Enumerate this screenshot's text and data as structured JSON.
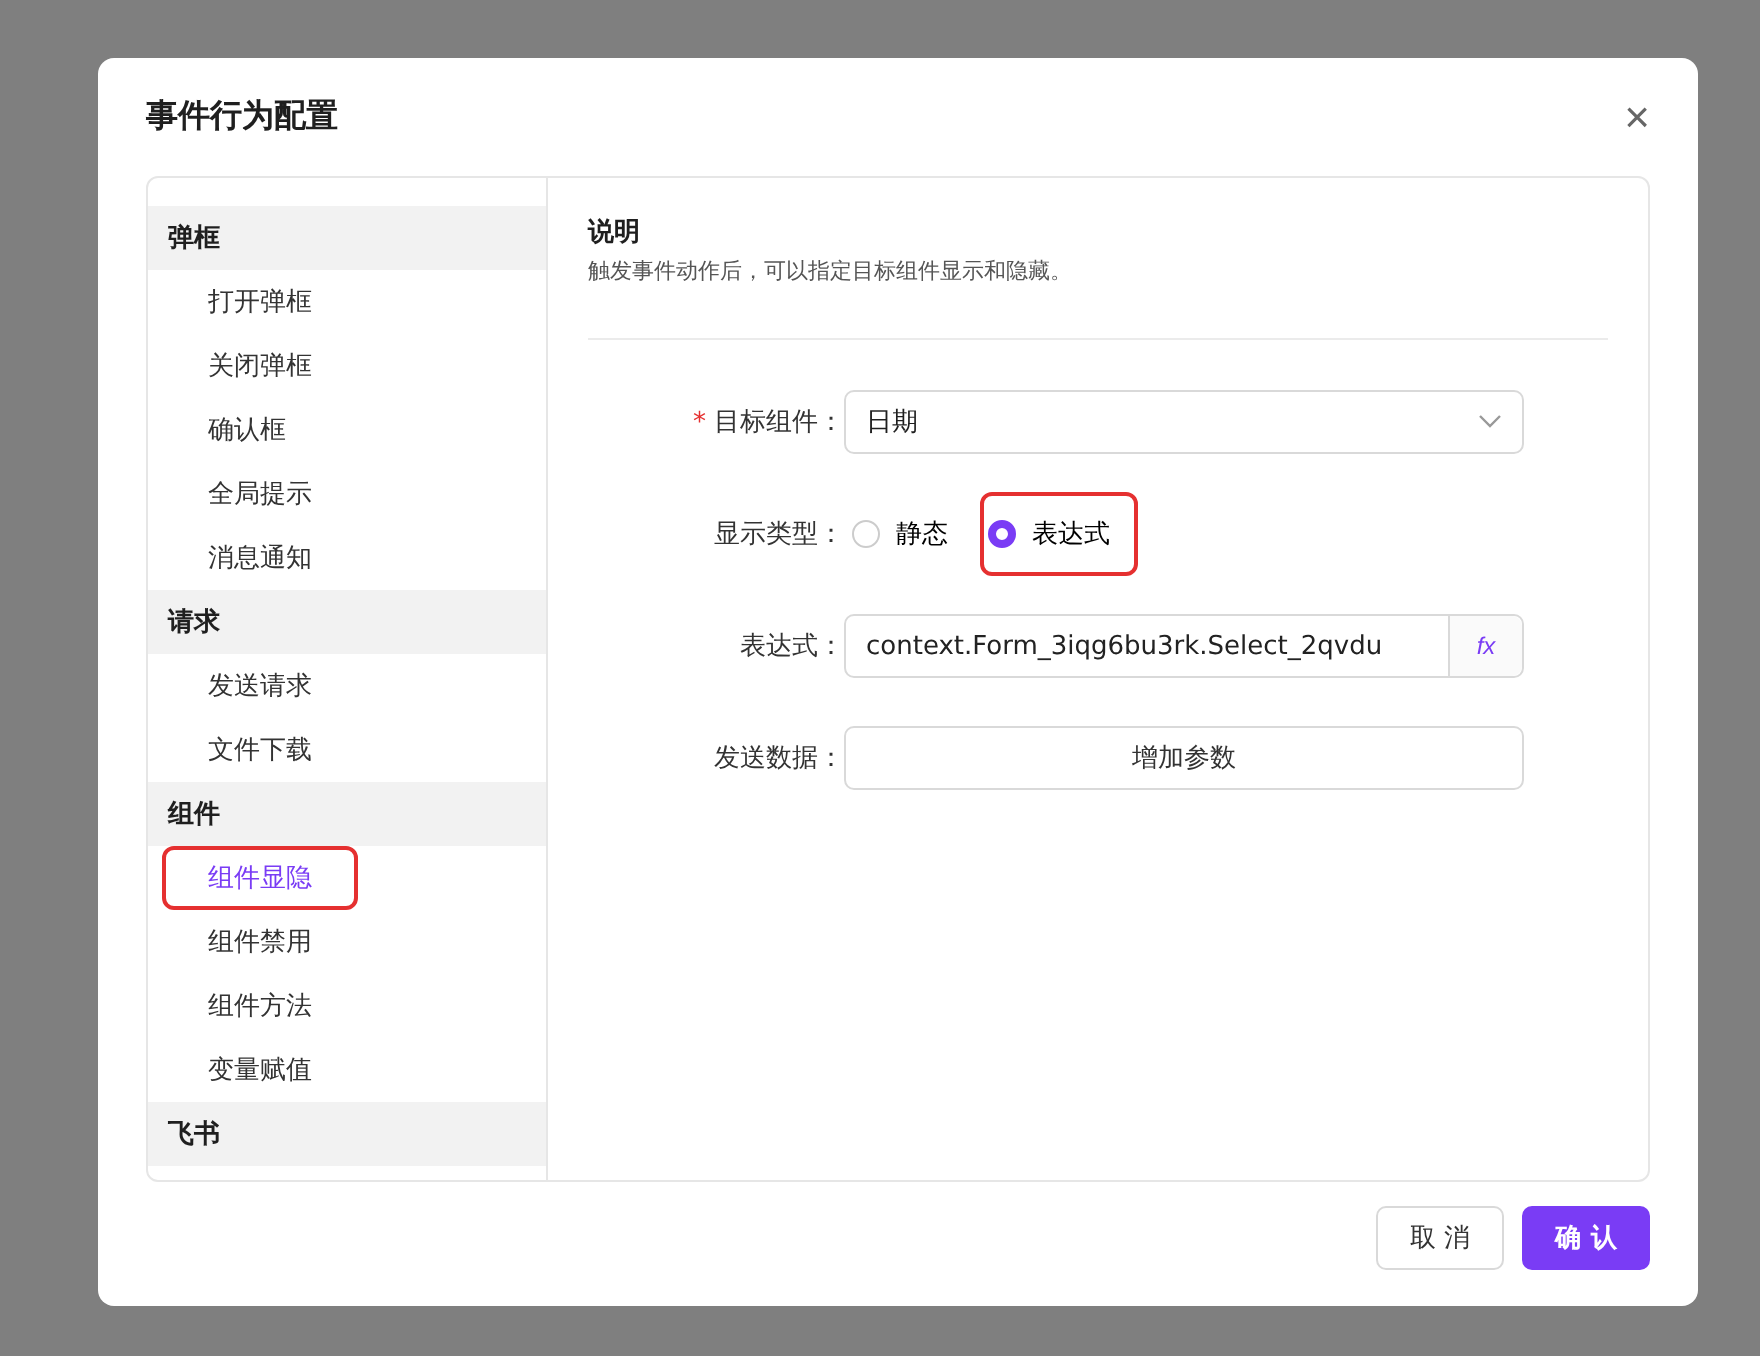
{
  "dialog": {
    "title": "事件行为配置",
    "close": "×"
  },
  "sidebar": {
    "groups": [
      {
        "label": "弹框",
        "items": [
          {
            "label": "打开弹框",
            "selected": false,
            "highlighted": false
          },
          {
            "label": "关闭弹框",
            "selected": false,
            "highlighted": false
          },
          {
            "label": "确认框",
            "selected": false,
            "highlighted": false
          },
          {
            "label": "全局提示",
            "selected": false,
            "highlighted": false
          },
          {
            "label": "消息通知",
            "selected": false,
            "highlighted": false
          }
        ]
      },
      {
        "label": "请求",
        "items": [
          {
            "label": "发送请求",
            "selected": false,
            "highlighted": false
          },
          {
            "label": "文件下载",
            "selected": false,
            "highlighted": false
          }
        ]
      },
      {
        "label": "组件",
        "items": [
          {
            "label": "组件显隐",
            "selected": true,
            "highlighted": true
          },
          {
            "label": "组件禁用",
            "selected": false,
            "highlighted": false
          },
          {
            "label": "组件方法",
            "selected": false,
            "highlighted": false
          },
          {
            "label": "变量赋值",
            "selected": false,
            "highlighted": false
          }
        ]
      },
      {
        "label": "飞书"
      }
    ]
  },
  "description": {
    "title": "说明",
    "text": "触发事件动作后，可以指定目标组件显示和隐藏。"
  },
  "form": [
    {
      "kind": "select",
      "label": "目标组件：",
      "required_mark": "*",
      "value": "日期"
    },
    {
      "kind": "radio",
      "label": "显示类型：",
      "options": [
        {
          "label": "静态",
          "selected": false,
          "highlighted": false
        },
        {
          "label": "表达式",
          "selected": true,
          "highlighted": true
        }
      ]
    },
    {
      "kind": "expression",
      "label": "表达式：",
      "value": "context.Form_3iqg6bu3rk.Select_2qvdu",
      "button": "fx"
    },
    {
      "kind": "button",
      "label": "发送数据：",
      "button": "增加参数"
    }
  ],
  "buttons": [
    {
      "label": "取 消",
      "kind": "default"
    },
    {
      "label": "确 认",
      "kind": "primary"
    }
  ]
}
